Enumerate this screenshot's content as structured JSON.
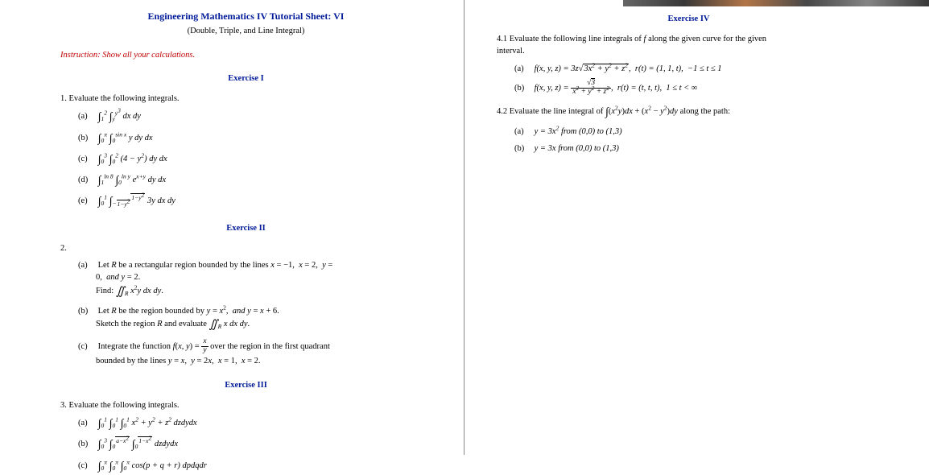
{
  "header": {
    "title": "Engineering Mathematics IV Tutorial Sheet: VI",
    "subtitle": "(Double, Triple, and Line Integral)",
    "instruction": "Instruction: Show all your calculations."
  },
  "ex1": {
    "heading": "Exercise I",
    "prompt": "1. Evaluate the following integrals.",
    "items": {
      "a": "∫₁² ∫ᵧ y³ dx dy",
      "b": "∫₀π ∫₀^{sin x} y dy dx",
      "c": "∫₀³ ∫₀² (4 − y²) dy dx",
      "d": "∫₁^{ln 8} ∫₀^{ln y} e^{x+y} dy dx",
      "e": "∫₀¹ ∫_{−√(1−y²)}^{√(1−y²)} 3y dx dy"
    }
  },
  "ex2": {
    "heading": "Exercise II",
    "number": "2.",
    "a": {
      "line1": "Let R be a rectangular region bounded by the lines x = −1,  x = 2,  y =",
      "line2": "0,  and y = 2.",
      "line3": "Find: ∬_R x²y dx dy."
    },
    "b": {
      "line1": "Let R be the region bounded by y = x²,  and y = x + 6.",
      "line2": "Sketch the region R and evaluate ∬_R x dx dy."
    },
    "c": {
      "line1": "Integrate the function f(x, y) = x⁄y over the region in the first quadrant",
      "line2": "bounded by the lines y = x,  y = 2x,  x = 1,  x = 2."
    }
  },
  "ex3": {
    "heading": "Exercise III",
    "prompt": "3. Evaluate the following integrals.",
    "items": {
      "a": "∫₀¹ ∫₀¹ ∫₀¹ x² + y² + z² dzdydx",
      "b": "∫₀³ ∫₀^{√(a−x²)} ∫₀^{√(1−x²)} dzdydx",
      "c": "∫₀π ∫₀π ∫₀π cos(p + q + r) dpdqdr"
    }
  },
  "ex4": {
    "heading": "Exercise IV",
    "intro": "4.1 Evaluate the following line integrals of f along the given curve for the given interval.",
    "a": {
      "text": "f(x, y, z) = 3z√(3x² + y² + z²),   r(t) = (1, 1, t),   −1 ≤ t ≤ 1"
    },
    "b": {
      "text": "f(x, y, z) = √3 ⁄ (x² + y² + z²),   r(t) = (t, t, t),   1 ≤ t < ∞"
    },
    "p42": {
      "intro": "4.2 Evaluate the line integral of ∫(x²y)dx + (x² − y²)dy along the path:",
      "a": "y = 3x² from (0,0) to (1,3)",
      "b": "y = 3x from (0,0) to (1,3)"
    }
  }
}
